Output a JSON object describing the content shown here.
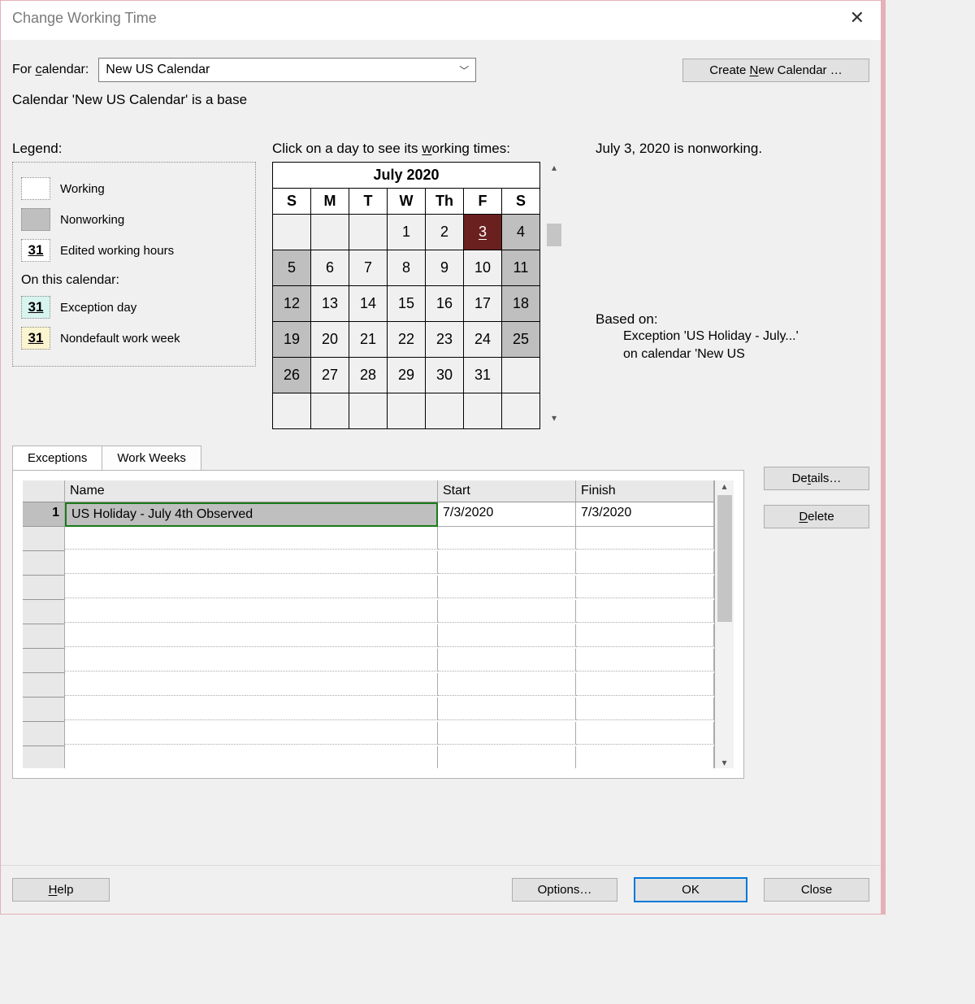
{
  "titlebar": {
    "title": "Change Working Time"
  },
  "top": {
    "for_calendar_label": "For calendar:",
    "calendar_selected": "New US Calendar",
    "create_new_label": "Create New Calendar …",
    "calendar_subtext": "Calendar 'New US Calendar' is a base"
  },
  "legend": {
    "title": "Legend:",
    "working": "Working",
    "nonworking": "Nonworking",
    "edited_hours": "Edited working hours",
    "on_this_calendar": "On this calendar:",
    "exception_day": "Exception day",
    "nondefault_ww": "Nondefault work week",
    "swatch_num": "31"
  },
  "calendar": {
    "instruction": "Click on a day to see its working times:",
    "month_title": "July 2020",
    "day_headers": [
      "S",
      "M",
      "T",
      "W",
      "Th",
      "F",
      "S"
    ],
    "cells": [
      [
        "",
        "",
        "",
        "1",
        "2",
        "3",
        "4"
      ],
      [
        "5",
        "6",
        "7",
        "8",
        "9",
        "10",
        "11"
      ],
      [
        "12",
        "13",
        "14",
        "15",
        "16",
        "17",
        "18"
      ],
      [
        "19",
        "20",
        "21",
        "22",
        "23",
        "24",
        "25"
      ],
      [
        "26",
        "27",
        "28",
        "29",
        "30",
        "31",
        ""
      ],
      [
        "",
        "",
        "",
        "",
        "",
        "",
        ""
      ]
    ],
    "selected_day_index": [
      0,
      5
    ]
  },
  "info": {
    "heading": "July 3, 2020 is nonworking.",
    "based_on_label": "Based on:",
    "based_on_detail_1": "Exception 'US Holiday - July...'",
    "based_on_detail_2": "on calendar 'New US"
  },
  "tabs": {
    "exceptions": "Exceptions",
    "workweeks": "Work Weeks"
  },
  "exceptions_table": {
    "headers": {
      "name": "Name",
      "start": "Start",
      "finish": "Finish"
    },
    "rows": [
      {
        "idx": "1",
        "name": "US Holiday - July 4th Observed",
        "start": "7/3/2020",
        "finish": "7/3/2020"
      }
    ]
  },
  "side_buttons": {
    "details": "Details…",
    "delete": "Delete"
  },
  "footer": {
    "help": "Help",
    "options": "Options…",
    "ok": "OK",
    "close": "Close"
  }
}
